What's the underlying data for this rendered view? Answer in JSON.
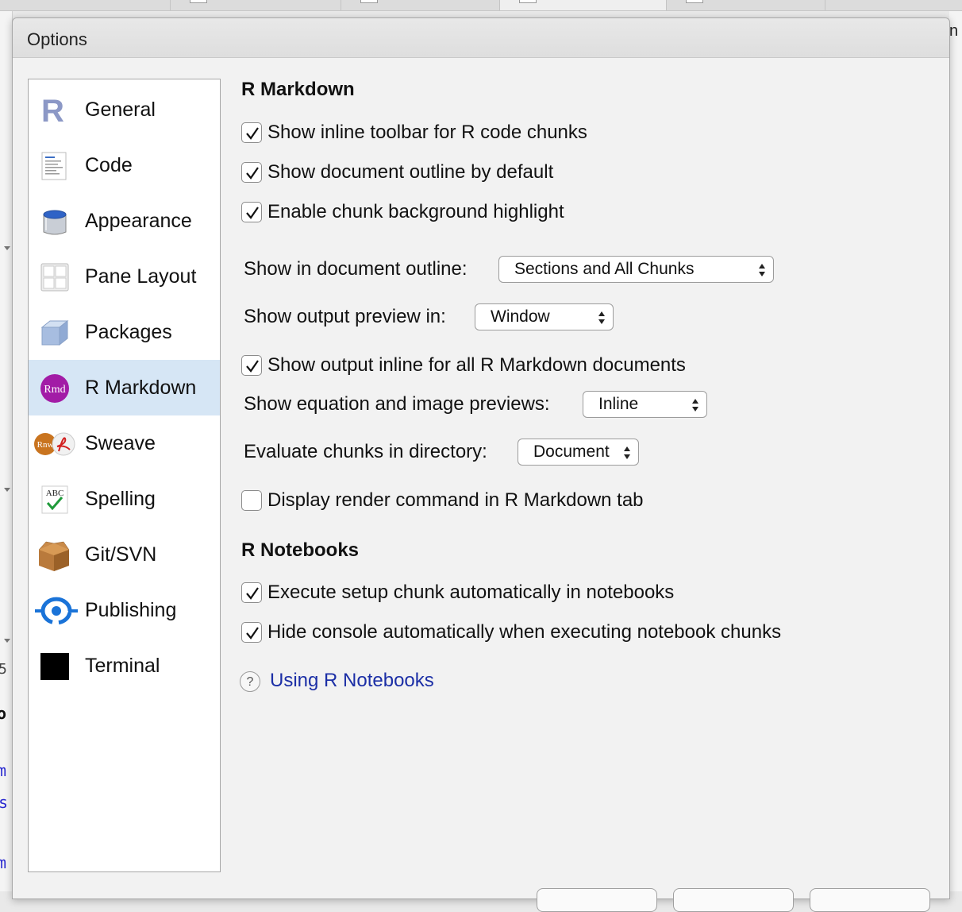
{
  "window": {
    "title": "Options"
  },
  "sidebar": {
    "items": [
      {
        "label": "General",
        "icon": "r-logo-icon"
      },
      {
        "label": "Code",
        "icon": "code-document-icon"
      },
      {
        "label": "Appearance",
        "icon": "paint-bucket-icon"
      },
      {
        "label": "Pane Layout",
        "icon": "pane-layout-icon"
      },
      {
        "label": "Packages",
        "icon": "package-box-icon"
      },
      {
        "label": "R Markdown",
        "icon": "rmd-icon",
        "badge": "Rmd",
        "selected": true
      },
      {
        "label": "Sweave",
        "icon": "sweave-icon",
        "badge": "Rnw"
      },
      {
        "label": "Spelling",
        "icon": "spelling-icon",
        "badge": "ABC"
      },
      {
        "label": "Git/SVN",
        "icon": "git-box-icon"
      },
      {
        "label": "Publishing",
        "icon": "publishing-icon"
      },
      {
        "label": "Terminal",
        "icon": "terminal-icon"
      }
    ]
  },
  "rmarkdown": {
    "title": "R Markdown",
    "show_inline_toolbar": {
      "label": "Show inline toolbar for R code chunks",
      "checked": true
    },
    "show_outline_default": {
      "label": "Show document outline by default",
      "checked": true
    },
    "chunk_highlight": {
      "label": "Enable chunk background highlight",
      "checked": true
    },
    "outline_select": {
      "label": "Show in document outline:",
      "value": "Sections and All Chunks"
    },
    "preview_select": {
      "label": "Show output preview in:",
      "value": "Window"
    },
    "show_output_inline": {
      "label": "Show output inline for all R Markdown documents",
      "checked": true
    },
    "equation_select": {
      "label": "Show equation and image previews:",
      "value": "Inline"
    },
    "eval_dir_select": {
      "label": "Evaluate chunks in directory:",
      "value": "Document"
    },
    "render_command": {
      "label": "Display render command in R Markdown tab",
      "checked": false
    }
  },
  "notebooks": {
    "title": "R Notebooks",
    "setup_chunk": {
      "label": "Execute setup chunk automatically in notebooks",
      "checked": true
    },
    "hide_console": {
      "label": "Hide console automatically when executing notebook chunks",
      "checked": true
    },
    "help_link": "Using R Notebooks",
    "help_icon": "?"
  },
  "background": {
    "right_edge_text": "n",
    "left_text_1": "o",
    "left_text_2": "m",
    "left_text_3": "s",
    "left_text_4": "m",
    "left_text_5": "5"
  },
  "colors": {
    "selected_row": "#d6e6f5",
    "link": "#1c2fa6",
    "rmd_purple": "#a21ca6",
    "publishing_blue": "#1a73d8"
  }
}
